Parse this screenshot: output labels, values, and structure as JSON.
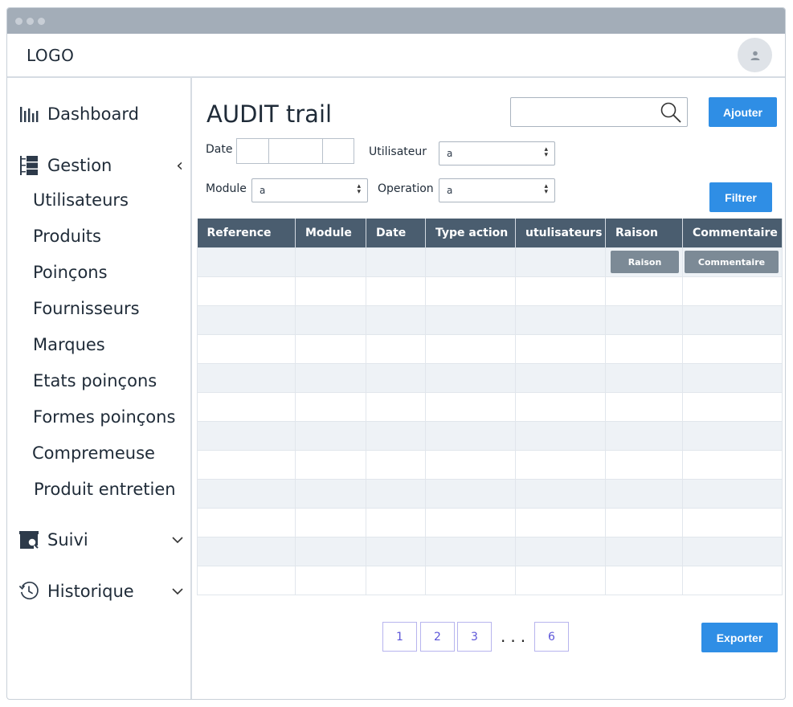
{
  "header": {
    "logo": "LOGO",
    "avatar_icon": "user-icon"
  },
  "sidebar": {
    "dashboard": {
      "label": "Dashboard",
      "icon": "bar-chart-icon"
    },
    "gestion": {
      "label": "Gestion",
      "icon": "list-icon",
      "chevron": "‹",
      "items": [
        "Utilisateurs",
        "Produits",
        "Poinçons",
        "Fournisseurs",
        "Marques",
        "Etats poinçons",
        "Formes poinçons",
        "Compremeuse",
        "Produit entretien"
      ]
    },
    "suivi": {
      "label": "Suivi",
      "icon": "monitor-search-icon",
      "chevron": "⌄"
    },
    "historique": {
      "label": "Historique",
      "icon": "history-icon",
      "chevron": "⌄"
    }
  },
  "main": {
    "title": "AUDIT trail",
    "search": {
      "value": "",
      "icon": "search-icon"
    },
    "add_button": "Ajouter",
    "filters": {
      "date_label": "Date",
      "utilisateur_label": "Utilisateur",
      "utilisateur_value": "a",
      "module_label": "Module",
      "module_value": "a",
      "operation_label": "Operation",
      "operation_value": "a",
      "filter_button": "Filtrer"
    },
    "table": {
      "columns": [
        "Reference",
        "Module",
        "Date",
        "Type action",
        "utulisateurs",
        "Raison",
        "Commentaire"
      ],
      "row_buttons": {
        "raison": "Raison",
        "commentaire": "Commentaire"
      }
    },
    "pagination": {
      "pages": [
        "1",
        "2",
        "3",
        "6"
      ],
      "ellipsis": "..."
    },
    "export_button": "Exporter"
  },
  "colors": {
    "primary": "#2f8ee5",
    "header_bg": "#4a5d6f",
    "titlebar": "#a3adb8",
    "page_accent": "#5c55d8"
  }
}
